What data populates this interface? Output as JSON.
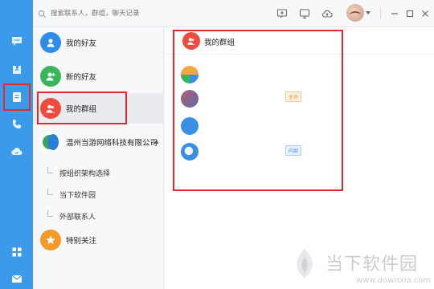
{
  "search": {
    "placeholder": "搜索联系人，群组，聊天记录"
  },
  "list": {
    "items": [
      {
        "label": "我的好友",
        "color": "#2f8ce8",
        "icon": "person-icon"
      },
      {
        "label": "新的好友",
        "color": "#39b55a",
        "icon": "add-person-icon"
      },
      {
        "label": "我的群组",
        "color": "#ee4b3e",
        "icon": "group-icon"
      }
    ],
    "org": {
      "label": "温州当游网络科技有限公司",
      "caret": "▲"
    },
    "sub_items": [
      "按组织架构选择",
      "当下软件园",
      "外部联系人"
    ],
    "special": {
      "label": "特别关注",
      "color": "#f39a2b",
      "icon": "star-icon"
    }
  },
  "main": {
    "title": "我的群组",
    "tags": {
      "all": "全员",
      "inner": "内部"
    }
  },
  "watermark": {
    "text": "当下软件园",
    "url": "www.downxia.com"
  },
  "colors": {
    "rail": "#3b9bea",
    "highlight": "#e12b2b"
  }
}
